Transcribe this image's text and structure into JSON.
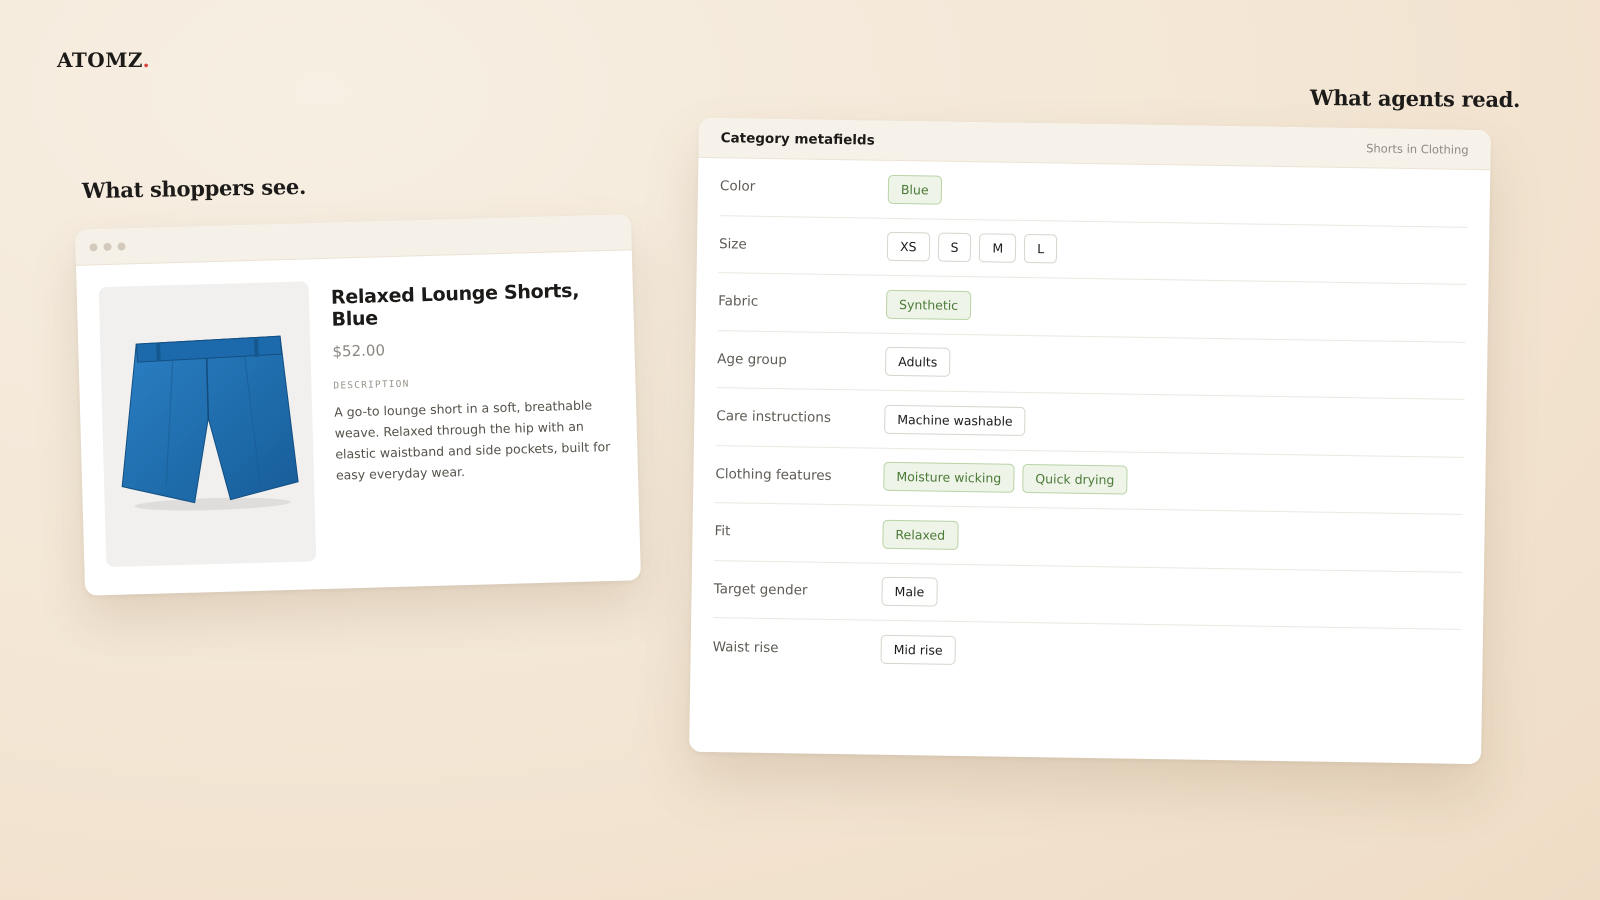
{
  "brand": {
    "name": "ATOMZ",
    "dot": "."
  },
  "headings": {
    "shoppers": "What shoppers see.",
    "agents": "What agents read."
  },
  "product": {
    "title": "Relaxed Lounge Shorts, Blue",
    "price": "$52.00",
    "description_label": "DESCRIPTION",
    "description": "A go-to lounge short in a soft, breathable weave. Relaxed through the hip with an elastic waistband and side pockets, built for easy everyday wear.",
    "image_icon": "blue-shorts-image",
    "image_color": "#1f6fb2"
  },
  "panel": {
    "title": "Category metafields",
    "subtitle": "Shorts in Clothing",
    "rows": [
      {
        "label": "Color",
        "chips": [
          {
            "text": "Blue",
            "green": true
          }
        ]
      },
      {
        "label": "Size",
        "chips": [
          {
            "text": "XS",
            "green": false
          },
          {
            "text": "S",
            "green": false
          },
          {
            "text": "M",
            "green": false
          },
          {
            "text": "L",
            "green": false
          }
        ]
      },
      {
        "label": "Fabric",
        "chips": [
          {
            "text": "Synthetic",
            "green": true
          }
        ]
      },
      {
        "label": "Age group",
        "chips": [
          {
            "text": "Adults",
            "green": false
          }
        ]
      },
      {
        "label": "Care instructions",
        "chips": [
          {
            "text": "Machine washable",
            "green": false
          }
        ]
      },
      {
        "label": "Clothing features",
        "chips": [
          {
            "text": "Moisture wicking",
            "green": true
          },
          {
            "text": "Quick drying",
            "green": true
          }
        ]
      },
      {
        "label": "Fit",
        "chips": [
          {
            "text": "Relaxed",
            "green": true
          }
        ]
      },
      {
        "label": "Target gender",
        "chips": [
          {
            "text": "Male",
            "green": false
          }
        ]
      },
      {
        "label": "Waist rise",
        "chips": [
          {
            "text": "Mid rise",
            "green": false
          }
        ]
      }
    ]
  },
  "colors": {
    "accent_dot": "#d9443a",
    "chip_green_bg": "#eef4e8",
    "chip_green_text": "#4c7a38"
  }
}
